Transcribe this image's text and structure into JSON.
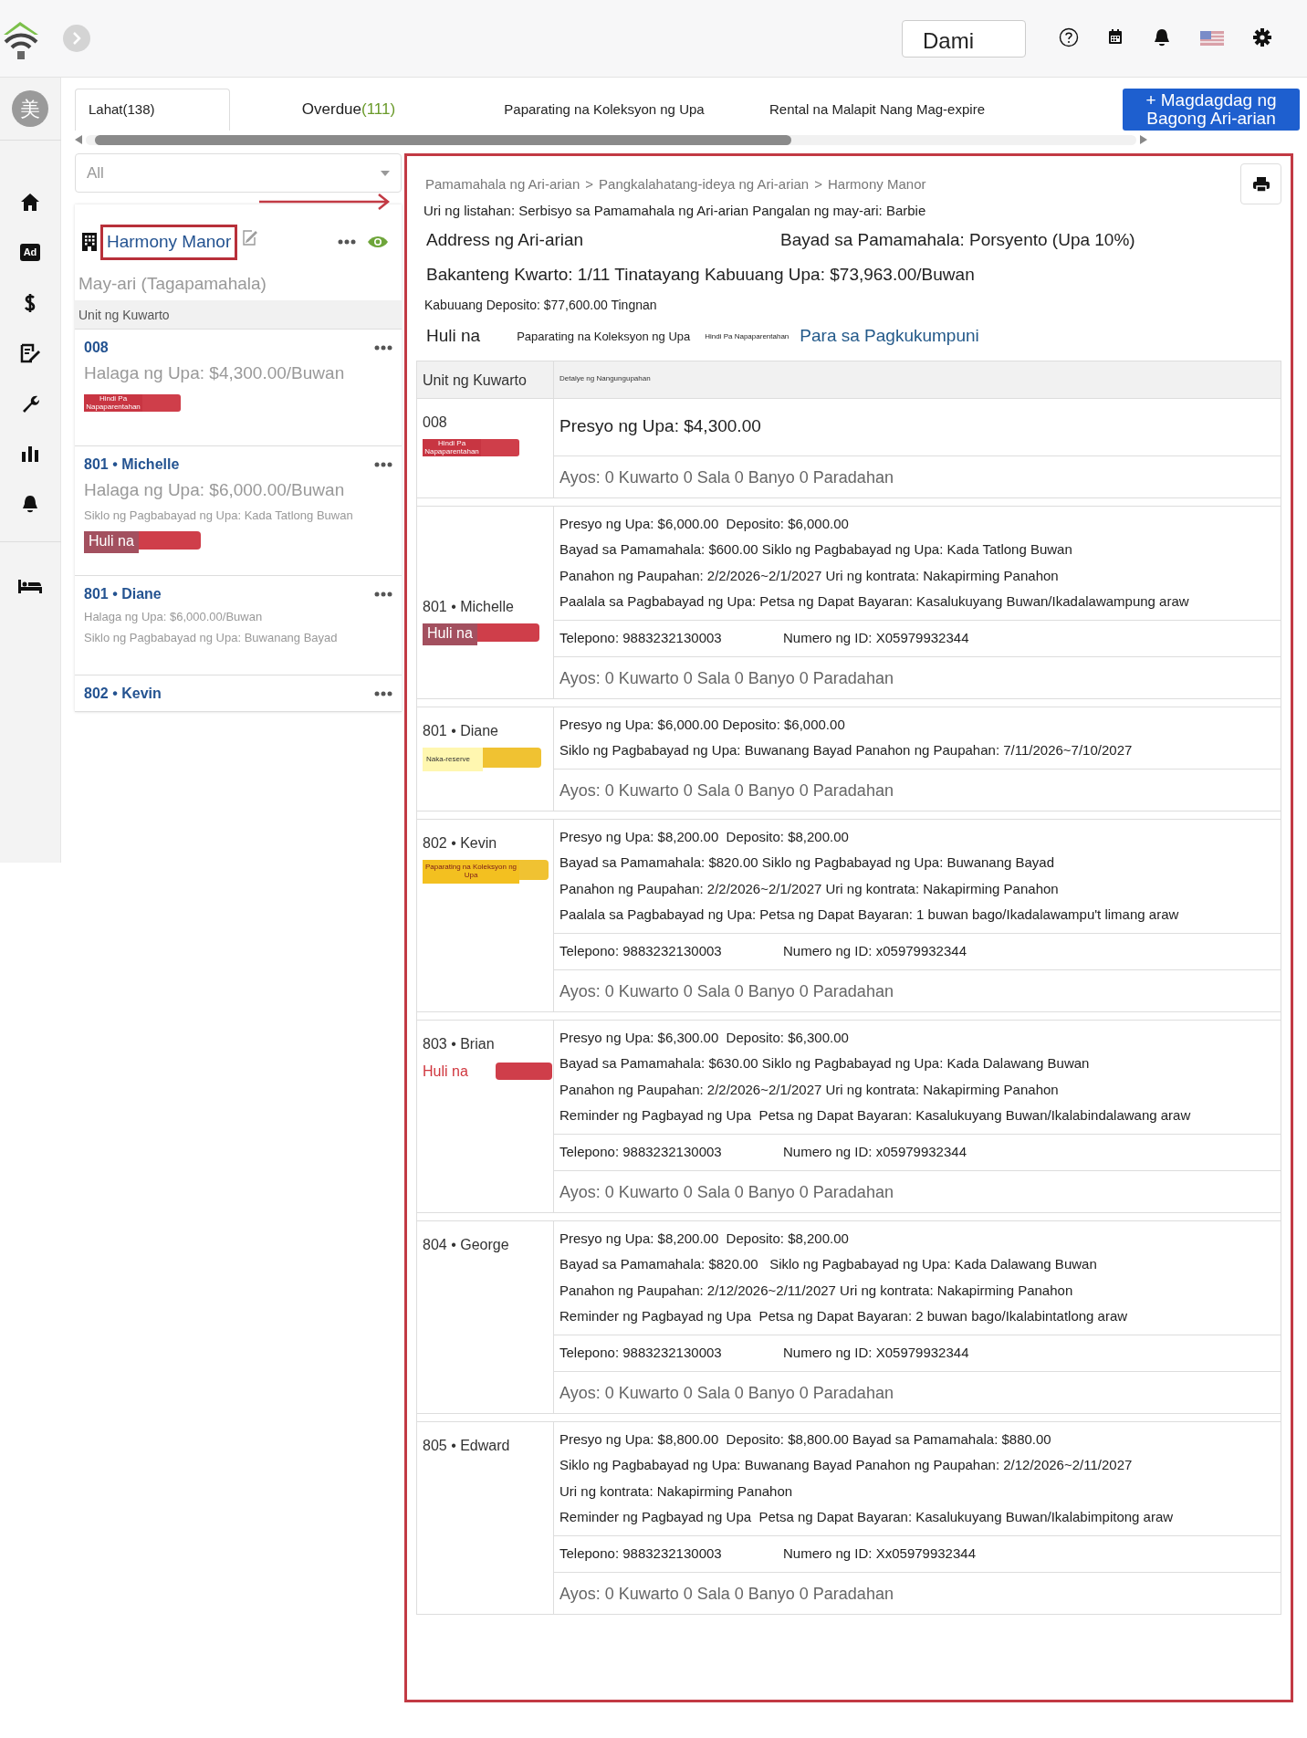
{
  "top_bar": {
    "user": "Dami",
    "icons": [
      {
        "kind": "help"
      },
      {
        "kind": "calendar"
      },
      {
        "kind": "bell"
      },
      {
        "kind": "flag"
      },
      {
        "kind": "settings"
      }
    ]
  },
  "sidebar": {
    "avatar": "美",
    "items": [
      {
        "kind": "home"
      },
      {
        "kind": "ad",
        "label": "Ad"
      },
      {
        "kind": "dollar"
      },
      {
        "kind": "edit"
      },
      {
        "kind": "wrench"
      },
      {
        "kind": "chart"
      },
      {
        "kind": "bell"
      },
      {
        "kind": "bed"
      }
    ]
  },
  "tabs": [
    {
      "label": "Lahat(138)",
      "selected": true
    },
    {
      "label": "Overdue",
      "count": "(111)",
      "selected": false
    },
    {
      "label": "Paparating na Koleksyon ng Upa",
      "selected": false
    },
    {
      "label": "Rental na Malapit Nang Mag-expire",
      "selected": false
    }
  ],
  "add_button": "+ Magdagdag ng Bagong Ari-arian",
  "filter": {
    "value": "All"
  },
  "property_card": {
    "name": "Harmony Manor",
    "owner_role": "May-ari (Tagapamahala)",
    "list_header": "Unit ng Kuwarto",
    "units": [
      {
        "unit": "008",
        "lines": [
          "Halaga ng Upa: $4,300.00/Buwan"
        ],
        "status": {
          "label": "Hindi Pa Napaparentahan",
          "kind": "vacant"
        }
      },
      {
        "unit": "801 • Michelle",
        "lines": [
          "Halaga ng Upa: $6,000.00/Buwan",
          "Siklo ng Pagbabayad ng Upa: Kada Tatlong Buwan"
        ],
        "status": {
          "label": "Huli na",
          "kind": "late"
        }
      },
      {
        "unit": "801 • Diane",
        "lines": [
          "Halaga ng Upa: $6,000.00/Buwan",
          "Siklo ng Pagbabayad ng Upa: Buwanang Bayad"
        ]
      },
      {
        "unit": "802 • Kevin"
      }
    ]
  },
  "detail": {
    "breadcrumbs": [
      "Pamamahala ng Ari-arian",
      "Pangkalahatang-ideya ng Ari-arian",
      "Harmony Manor"
    ],
    "breadcrumb_separator": ">",
    "listing_line": "Uri ng listahan: Serbisyo sa Pamamahala ng Ari-arian Pangalan ng may-ari: Barbie",
    "address_label": "Address ng Ari-arian",
    "management_fee": "Bayad sa Pamamahala: Porsyento (Upa 10%)",
    "summary": "Bakanteng Kwarto: 1/11 Tinatayang Kabuuang Upa: $73,963.00/Buwan",
    "deposit": "Kabuuang Deposito: $77,600.00 Tingnan",
    "legend": [
      {
        "label": "Huli na",
        "kind": "late"
      },
      {
        "label": "Paparating na Koleksyon ng Upa",
        "kind": "upcoming"
      },
      {
        "label": "Hindi Pa Napaparentahan",
        "kind": "vacant"
      },
      {
        "label": "Para sa Pagkukumpuni",
        "kind": "repair"
      }
    ],
    "table": {
      "columns": [
        "Unit ng Kuwarto",
        "Detalye ng Nangungupahan"
      ],
      "rows": [
        {
          "unit": "008",
          "status": {
            "label": "Hindi Pa Napaparentahan",
            "kind": "vacant"
          },
          "info": [
            "Presyo ng Upa: $4,300.00"
          ],
          "layout": "Ayos: 0 Kuwarto 0 Sala 0 Banyo 0 Paradahan"
        },
        {
          "unit": "801 • Michelle",
          "status": {
            "label": "Huli na",
            "kind": "late"
          },
          "info": [
            "Presyo ng Upa: $6,000.00  Deposito: $6,000.00",
            "Bayad sa Pamamahala: $600.00 Siklo ng Pagbabayad ng Upa: Kada Tatlong Buwan",
            "Panahon ng Paupahan: 2/2/2026~2/1/2027 Uri ng kontrata: Nakapirming Panahon",
            "Paalala sa Pagbabayad ng Upa: Petsa ng Dapat Bayaran: Kasalukuyang Buwan/Ikadalawampung araw"
          ],
          "phone": "Telepono: 9883232130003",
          "id_number": "Numero ng ID: X05979932344",
          "layout": "Ayos: 0 Kuwarto 0 Sala 0 Banyo 0 Paradahan"
        },
        {
          "unit": "801 • Diane",
          "status": {
            "label": "Naka-reserve",
            "kind": "reserved"
          },
          "info": [
            "Presyo ng Upa: $6,000.00 Deposito: $6,000.00",
            "Siklo ng Pagbabayad ng Upa: Buwanang Bayad Panahon ng Paupahan: 7/11/2026~7/10/2027"
          ],
          "layout": "Ayos: 0 Kuwarto 0 Sala 0 Banyo 0 Paradahan"
        },
        {
          "unit": "802 • Kevin",
          "status": {
            "label": "Paparating na Koleksyon ng Upa",
            "kind": "upcoming"
          },
          "info": [
            "Presyo ng Upa: $8,200.00  Deposito: $8,200.00",
            "Bayad sa Pamamahala: $820.00 Siklo ng Pagbabayad ng Upa: Buwanang Bayad",
            "Panahon ng Paupahan: 2/2/2026~2/1/2027 Uri ng kontrata: Nakapirming Panahon",
            "Paalala sa Pagbabayad ng Upa: Petsa ng Dapat Bayaran: 1 buwan bago/Ikadalawampu't limang araw"
          ],
          "phone": "Telepono: 9883232130003",
          "id_number": "Numero ng ID: x05979932344",
          "layout": "Ayos: 0 Kuwarto 0 Sala 0 Banyo 0 Paradahan"
        },
        {
          "unit": "803 • Brian",
          "status": {
            "label": "Huli na",
            "kind": "late-plain"
          },
          "info": [
            "Presyo ng Upa: $6,300.00  Deposito: $6,300.00",
            "Bayad sa Pamamahala: $630.00 Siklo ng Pagbabayad ng Upa: Kada Dalawang Buwan",
            "Panahon ng Paupahan: 2/2/2026~2/1/2027 Uri ng kontrata: Nakapirming Panahon",
            "Reminder ng Pagbayad ng Upa  Petsa ng Dapat Bayaran: Kasalukuyang Buwan/Ikalabindalawang araw"
          ],
          "phone": "Telepono: 9883232130003",
          "id_number": "Numero ng ID: x05979932344",
          "layout": "Ayos: 0 Kuwarto 0 Sala 0 Banyo 0 Paradahan"
        },
        {
          "unit": "804 • George",
          "info": [
            "Presyo ng Upa: $8,200.00  Deposito: $8,200.00",
            "Bayad sa Pamamahala: $820.00   Siklo ng Pagbabayad ng Upa: Kada Dalawang Buwan",
            "Panahon ng Paupahan: 2/12/2026~2/11/2027 Uri ng kontrata: Nakapirming Panahon",
            "Reminder ng Pagbayad ng Upa  Petsa ng Dapat Bayaran: 2 buwan bago/Ikalabintatlong araw"
          ],
          "phone": "Telepono: 9883232130003",
          "id_number": "Numero ng ID: X05979932344",
          "layout": "Ayos: 0 Kuwarto 0 Sala 0 Banyo 0 Paradahan"
        },
        {
          "unit": "805 • Edward",
          "info": [
            "Presyo ng Upa: $8,800.00  Deposito: $8,800.00 Bayad sa Pamamahala: $880.00",
            "Siklo ng Pagbabayad ng Upa: Buwanang Bayad Panahon ng Paupahan: 2/12/2026~2/11/2027",
            "Uri ng kontrata: Nakapirming Panahon",
            "Reminder ng Pagbayad ng Upa  Petsa ng Dapat Bayaran: Kasalukuyang Buwan/Ikalabimpitong araw"
          ],
          "phone": "Telepono: 9883232130003",
          "id_number": "Numero ng ID: Xx05979932344",
          "layout": "Ayos: 0 Kuwarto 0 Sala 0 Banyo 0 Paradahan"
        }
      ]
    }
  }
}
